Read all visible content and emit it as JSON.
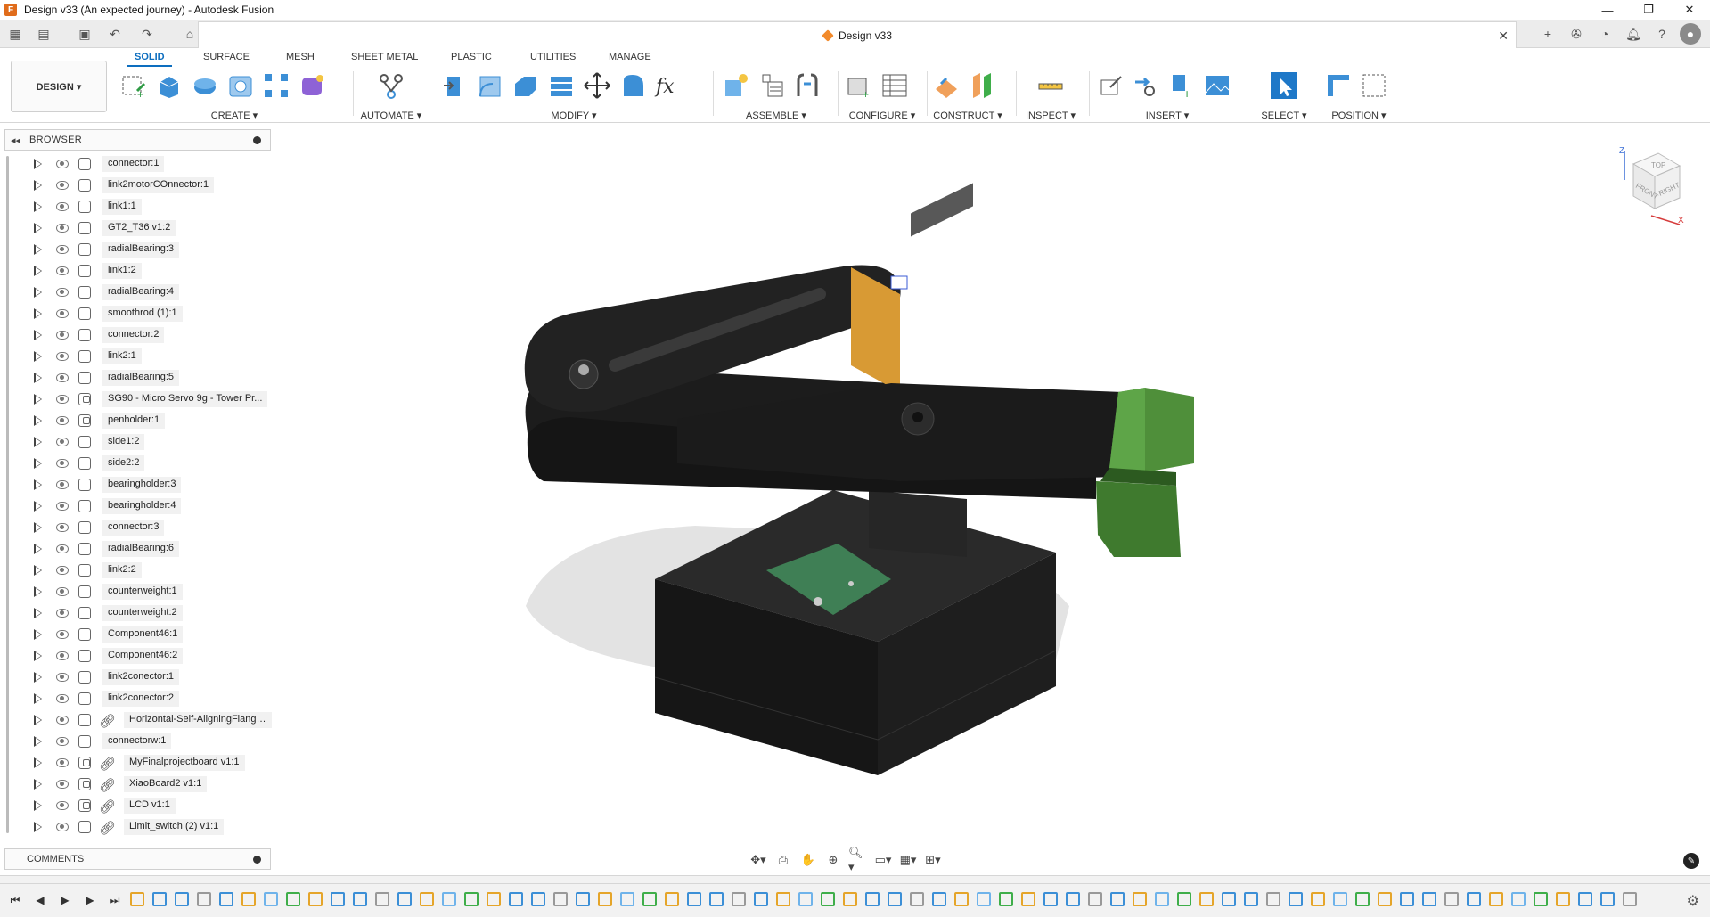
{
  "window": {
    "title": "Design v33 (An expected journey) - Autodesk Fusion",
    "controls": [
      "—",
      "❐",
      "✕"
    ]
  },
  "document_tab": {
    "label": "Design v33",
    "close": "✕"
  },
  "ribbon": {
    "tabs": [
      "SOLID",
      "SURFACE",
      "MESH",
      "SHEET METAL",
      "PLASTIC",
      "UTILITIES",
      "MANAGE"
    ],
    "active_tab": "SOLID",
    "workspace": "DESIGN ▾",
    "groups": [
      {
        "label": "CREATE ▾"
      },
      {
        "label": "AUTOMATE ▾"
      },
      {
        "label": "MODIFY ▾"
      },
      {
        "label": "ASSEMBLE ▾"
      },
      {
        "label": "CONFIGURE ▾"
      },
      {
        "label": "CONSTRUCT ▾"
      },
      {
        "label": "INSPECT ▾"
      },
      {
        "label": "INSERT ▾"
      },
      {
        "label": "SELECT ▾"
      },
      {
        "label": "POSITION ▾"
      }
    ]
  },
  "browser": {
    "title": "BROWSER",
    "items": [
      {
        "label": "connector:1",
        "linked": false,
        "xref": false
      },
      {
        "label": "link2motorCOnnector:1",
        "linked": false,
        "xref": false
      },
      {
        "label": "link1:1",
        "linked": false,
        "xref": false
      },
      {
        "label": "GT2_T36 v1:2",
        "linked": false,
        "xref": false
      },
      {
        "label": "radialBearing:3",
        "linked": false,
        "xref": false
      },
      {
        "label": "link1:2",
        "linked": false,
        "xref": false
      },
      {
        "label": "radialBearing:4",
        "linked": false,
        "xref": false
      },
      {
        "label": "smoothrod (1):1",
        "linked": false,
        "xref": false
      },
      {
        "label": "connector:2",
        "linked": false,
        "xref": false
      },
      {
        "label": "link2:1",
        "linked": false,
        "xref": false
      },
      {
        "label": "radialBearing:5",
        "linked": false,
        "xref": false
      },
      {
        "label": "SG90 - Micro Servo 9g - Tower Pr...",
        "linked": true,
        "xref": false
      },
      {
        "label": "penholder:1",
        "linked": true,
        "xref": false
      },
      {
        "label": "side1:2",
        "linked": false,
        "xref": false
      },
      {
        "label": "side2:2",
        "linked": false,
        "xref": false
      },
      {
        "label": "bearingholder:3",
        "linked": false,
        "xref": false
      },
      {
        "label": "bearingholder:4",
        "linked": false,
        "xref": false
      },
      {
        "label": "connector:3",
        "linked": false,
        "xref": false
      },
      {
        "label": "radialBearing:6",
        "linked": false,
        "xref": false
      },
      {
        "label": "link2:2",
        "linked": false,
        "xref": false
      },
      {
        "label": "counterweight:1",
        "linked": false,
        "xref": false
      },
      {
        "label": "counterweight:2",
        "linked": false,
        "xref": false
      },
      {
        "label": "Component46:1",
        "linked": false,
        "xref": false
      },
      {
        "label": "Component46:2",
        "linked": false,
        "xref": false
      },
      {
        "label": "link2conector:1",
        "linked": false,
        "xref": false
      },
      {
        "label": "link2conector:2",
        "linked": false,
        "xref": false
      },
      {
        "label": "Horizontal-Self-AligningFlange...",
        "linked": false,
        "xref": true
      },
      {
        "label": "connectorw:1",
        "linked": false,
        "xref": false
      },
      {
        "label": "MyFinalprojectboard v1:1",
        "linked": true,
        "xref": true
      },
      {
        "label": "XiaoBoard2 v1:1",
        "linked": true,
        "xref": true
      },
      {
        "label": "LCD v1:1",
        "linked": true,
        "xref": true
      },
      {
        "label": "Limit_switch (2) v1:1",
        "linked": false,
        "xref": true
      }
    ]
  },
  "comments": {
    "title": "COMMENTS"
  },
  "viewcube": {
    "faces": [
      "TOP",
      "FRONT",
      "RIGHT"
    ],
    "axes": [
      "Z",
      "X"
    ]
  },
  "colors": {
    "accent": "#0d6ebf",
    "model_dark": "#1c1c1c",
    "model_green": "#4f8f3a",
    "model_orange": "#d89a34",
    "pcb": "#3f7f55"
  }
}
